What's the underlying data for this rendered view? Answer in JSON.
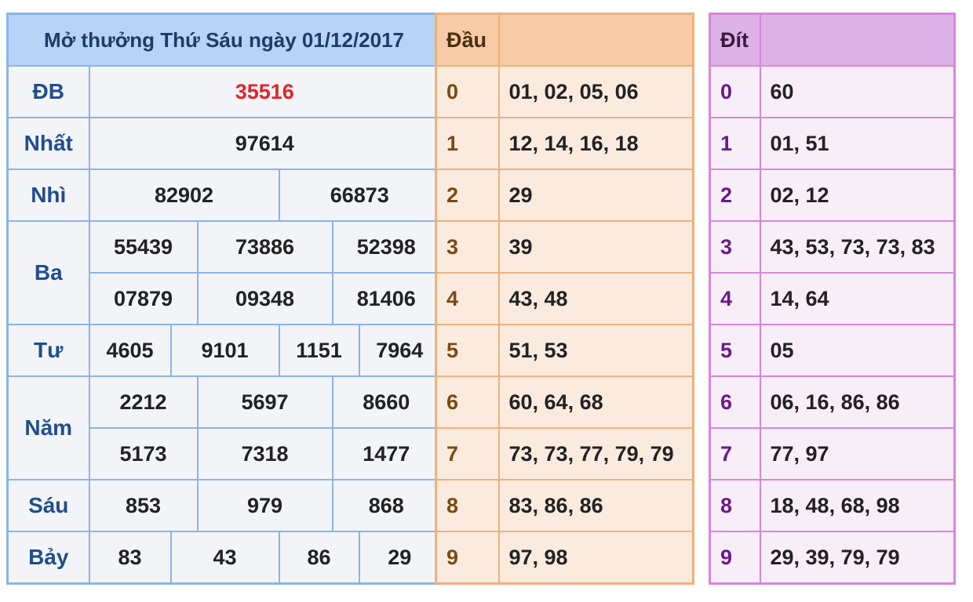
{
  "results": {
    "title": "Mở thưởng Thứ Sáu ngày 01/12/2017",
    "db": {
      "label": "ĐB",
      "values": [
        "35516"
      ]
    },
    "nhat": {
      "label": "Nhất",
      "values": [
        "97614"
      ]
    },
    "nhi": {
      "label": "Nhì",
      "values": [
        "82902",
        "66873"
      ]
    },
    "ba": {
      "label": "Ba",
      "values": [
        "55439",
        "73886",
        "52398",
        "07879",
        "09348",
        "81406"
      ]
    },
    "tu": {
      "label": "Tư",
      "values": [
        "4605",
        "9101",
        "1151",
        "7964"
      ]
    },
    "nam": {
      "label": "Năm",
      "values": [
        "2212",
        "5697",
        "8660",
        "5173",
        "7318",
        "1477"
      ]
    },
    "sau": {
      "label": "Sáu",
      "values": [
        "853",
        "979",
        "868"
      ]
    },
    "bay": {
      "label": "Bảy",
      "values": [
        "83",
        "43",
        "86",
        "29"
      ]
    }
  },
  "dau": {
    "header": "Đầu",
    "header_value": "",
    "rows": [
      {
        "key": "0",
        "value": "01, 02, 05, 06"
      },
      {
        "key": "1",
        "value": "12, 14, 16, 18"
      },
      {
        "key": "2",
        "value": "29"
      },
      {
        "key": "3",
        "value": "39"
      },
      {
        "key": "4",
        "value": "43, 48"
      },
      {
        "key": "5",
        "value": "51, 53"
      },
      {
        "key": "6",
        "value": "60, 64, 68"
      },
      {
        "key": "7",
        "value": "73, 73, 77, 79, 79"
      },
      {
        "key": "8",
        "value": "83, 86, 86"
      },
      {
        "key": "9",
        "value": "97, 98"
      }
    ]
  },
  "dit": {
    "header": "Đít",
    "header_value": "",
    "rows": [
      {
        "key": "0",
        "value": "60"
      },
      {
        "key": "1",
        "value": "01, 51"
      },
      {
        "key": "2",
        "value": "02, 12"
      },
      {
        "key": "3",
        "value": "43, 53, 73, 73, 83"
      },
      {
        "key": "4",
        "value": "14, 64"
      },
      {
        "key": "5",
        "value": "05"
      },
      {
        "key": "6",
        "value": "06, 16, 86, 86"
      },
      {
        "key": "7",
        "value": "77, 97"
      },
      {
        "key": "8",
        "value": "18, 48, 68, 98"
      },
      {
        "key": "9",
        "value": "29, 39, 79, 79"
      }
    ]
  },
  "colors": {
    "results_border": "#8ab4ea",
    "dau_border": "#f0b07a",
    "dit_border": "#d985db",
    "special_prize": "#e0262a"
  }
}
